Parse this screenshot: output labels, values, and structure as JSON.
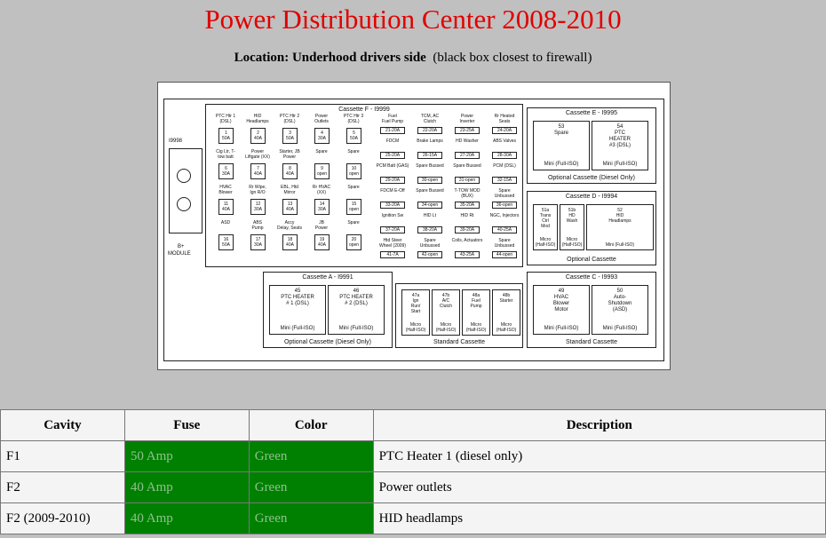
{
  "page": {
    "title": "Power Distribution Center 2008-2010",
    "location_label": "Location: Underhood drivers side",
    "location_note": "(black box closest to firewall)"
  },
  "diagram": {
    "module_id": "I9998",
    "module_name_line1": "B+",
    "module_name_line2": "MODULE",
    "cassette_f": {
      "title": "Cassette F - I9999",
      "left_cols": [
        [
          {
            "label": "PTC Htr 1\n(DSL)",
            "box": "1\n50A"
          },
          {
            "label": "Cig Ltr, T-\ntow batt",
            "box": "6\n30A"
          },
          {
            "label": "HVAC\nBlower",
            "box": "11\n40A"
          },
          {
            "label": "ASD",
            "box": "16\n50A"
          }
        ],
        [
          {
            "label": "HID\nHeadlamps",
            "box": "2\n40A"
          },
          {
            "label": "Power\nLiftgate (XX)",
            "box": "7\n40A"
          },
          {
            "label": "Rr Wipe,\nIgn R/O",
            "box": "12\n30A"
          },
          {
            "label": "ABS\nPump",
            "box": "17\n30A"
          }
        ],
        [
          {
            "label": "PTC Htr 2\n(DSL)",
            "box": "3\n50A"
          },
          {
            "label": "Starter, JB\nPower",
            "box": "8\n40A"
          },
          {
            "label": "EBL, Htd\nMirror",
            "box": "13\n40A"
          },
          {
            "label": "Accy\nDelay, Seats",
            "box": "18\n40A"
          }
        ],
        [
          {
            "label": "Power\nOutlets",
            "box": "4\n30A"
          },
          {
            "label": "Spare",
            "box": "9\nopen"
          },
          {
            "label": "Rr HVAC\n(XX)",
            "box": "14\n30A"
          },
          {
            "label": "JB\nPower",
            "box": "19\n40A"
          }
        ],
        [
          {
            "label": "PTC Htr 3\n(DSL)",
            "box": "5\n50A"
          },
          {
            "label": "Spare",
            "box": "10\nopen"
          },
          {
            "label": "Spare",
            "box": "15\nopen"
          },
          {
            "label": "Spare",
            "box": "20\nopen"
          }
        ]
      ],
      "right_cols": [
        [
          {
            "label": "Fuel\nFuel Pump",
            "box": "21-20A"
          },
          {
            "label": "FDCM",
            "box": "25-20A"
          },
          {
            "label": "PCM Batt (GAS)",
            "box": "29-20A"
          },
          {
            "label": "FDCM E-Off",
            "box": "33-20A"
          },
          {
            "label": "Ignition Sw",
            "box": "37-20A"
          },
          {
            "label": "Htd Steer\nWheel (2009)",
            "box": "41-7A"
          }
        ],
        [
          {
            "label": "TCM, AC\nClutch",
            "box": "22-20A"
          },
          {
            "label": "Brake Lamps",
            "box": "26-15A"
          },
          {
            "label": "Spare Bussed",
            "box": "30-open"
          },
          {
            "label": "Spare Bussed",
            "box": "34-open"
          },
          {
            "label": "HID Lt",
            "box": "38-20A"
          },
          {
            "label": "Spare\nUnbussed",
            "box": "42-open"
          }
        ],
        [
          {
            "label": "Power\nInverter",
            "box": "23-25A"
          },
          {
            "label": "HD Washer",
            "box": "27-20A"
          },
          {
            "label": "Spare Bussed",
            "box": "31-open"
          },
          {
            "label": "T-TOW MOD\n(BUX)",
            "box": "35-20A"
          },
          {
            "label": "HID Rt",
            "box": "39-20A"
          },
          {
            "label": "Coils, Actuators",
            "box": "43-25A"
          }
        ],
        [
          {
            "label": "Rr Heated\nSeats",
            "box": "24-20A"
          },
          {
            "label": "ABS Valves",
            "box": "28-30A"
          },
          {
            "label": "PCM (DSL)",
            "box": "32-15A"
          },
          {
            "label": "Spare\nUnbussed",
            "box": "36-open"
          },
          {
            "label": "NGC, Injectors",
            "box": "40-25A"
          },
          {
            "label": "Spare\nUnbussed",
            "box": "44-open"
          }
        ]
      ]
    },
    "cassette_e": {
      "title": "Cassette E - I9995",
      "footer": "Optional Cassette (Diesel Only)",
      "boxes": [
        {
          "text": "53\nSpare",
          "bottom": "Mini (Full-ISO)"
        },
        {
          "text": "54\nPTC\nHEATER\n#3 (DSL)",
          "bottom": "Mini (Full-ISO)"
        }
      ]
    },
    "cassette_d": {
      "title": "Cassette D - I9994",
      "footer": "Optional Cassette",
      "boxes": [
        {
          "text": "51a\nTrans\nCtrl\nMod",
          "bottom": "Micro\n(Half-ISO)"
        },
        {
          "text": "51b\nHD\nWash",
          "bottom": "Micro\n(Half-ISO)"
        },
        {
          "text": "52\nHID\nHeadlamps",
          "bottom": "Mini (Full-ISO)"
        }
      ]
    },
    "cassette_a": {
      "title": "Cassette A - I9991",
      "footer": "Optional Cassette (Diesel Only)",
      "boxes": [
        {
          "text": "45\nPTC HEATER\n# 1 (DSL)",
          "bottom": "Mini (Full-ISO)"
        },
        {
          "text": "46\nPTC HEATER\n# 2 (DSL)",
          "bottom": "Mini (Full-ISO)"
        }
      ]
    },
    "cassette_std": {
      "footer": "Standard Cassette",
      "boxes": [
        {
          "text": "47a\nIgn\nRun/\nStart",
          "bottom": "Micro\n(Half-ISO)"
        },
        {
          "text": "47b\nA/C\nClutch",
          "bottom": "Micro\n(Half-ISO)"
        },
        {
          "text": "48a\nFuel\nPump",
          "bottom": "Micro\n(Half-ISO)"
        },
        {
          "text": "48b\nStarter",
          "bottom": "Micro\n(Half-ISO)"
        }
      ]
    },
    "cassette_c": {
      "title": "Cassette C - I9993",
      "footer": "Standard Cassette",
      "boxes": [
        {
          "text": "49\nHVAC\nBlower\nMotor",
          "bottom": "Mini (Full-ISO)"
        },
        {
          "text": "50\nAuto-\nShutdown\n(ASD)",
          "bottom": "Mini (Full-ISO)"
        }
      ]
    }
  },
  "table": {
    "headers": [
      "Cavity",
      "Fuse",
      "Color",
      "Description"
    ],
    "rows": [
      {
        "cavity": "F1",
        "fuse": "50 Amp",
        "color": "Green",
        "description": "PTC Heater 1 (diesel only)"
      },
      {
        "cavity": "F2",
        "fuse": "40 Amp",
        "color": "Green",
        "description": "Power outlets"
      },
      {
        "cavity": "F2 (2009-2010)",
        "fuse": "40 Amp",
        "color": "Green",
        "description": "HID headlamps"
      }
    ],
    "fuse_cell_color": "#008000"
  }
}
